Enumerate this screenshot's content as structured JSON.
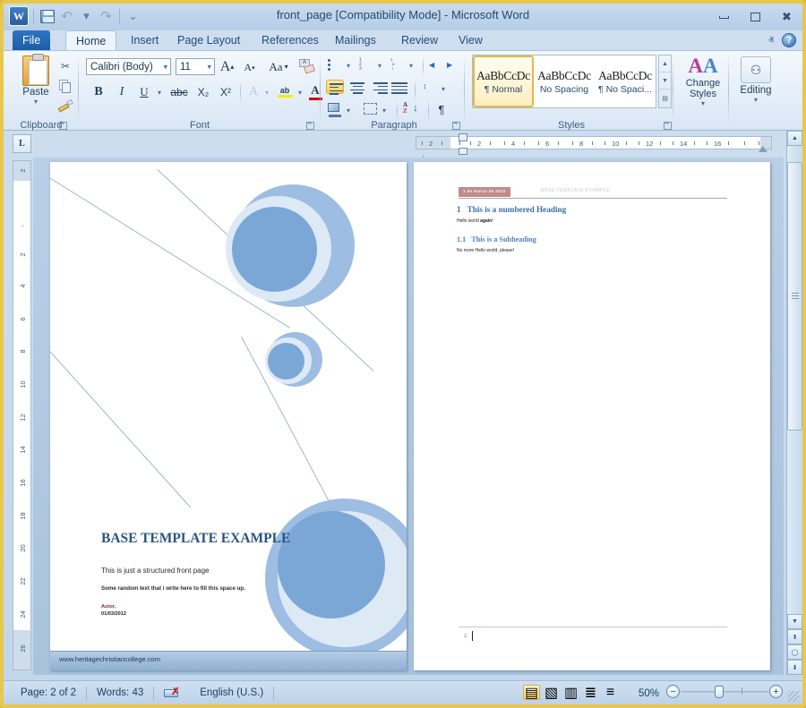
{
  "window": {
    "title": "front_page [Compatibility Mode]  -  Microsoft Word",
    "app_logo": "W",
    "minimize": "minimize-icon",
    "restore": "restore-icon",
    "close": "✖"
  },
  "quick_access": {
    "save": "save-icon",
    "undo": "↶",
    "redo": "↷",
    "customize": "≡▾"
  },
  "tabs": [
    {
      "label": "File",
      "id": "file"
    },
    {
      "label": "Home",
      "id": "home"
    },
    {
      "label": "Insert",
      "id": "insert"
    },
    {
      "label": "Page Layout",
      "id": "page-layout"
    },
    {
      "label": "References",
      "id": "references"
    },
    {
      "label": "Mailings",
      "id": "mailings"
    },
    {
      "label": "Review",
      "id": "review"
    },
    {
      "label": "View",
      "id": "view"
    }
  ],
  "ribbon_help": {
    "collapse": "ⱏ",
    "help": "?"
  },
  "ribbon": {
    "clipboard": {
      "name": "Clipboard",
      "paste": "Paste",
      "cut": "✂",
      "copy": "copy-icon",
      "format_painter": "format-painter-icon"
    },
    "font": {
      "name": "Font",
      "font_family": "Calibri (Body)",
      "font_size": "11",
      "grow_font": "A",
      "shrink_font": "A",
      "change_case": "Aa",
      "clear_formatting": "clear-formatting-icon",
      "bold": "B",
      "italic": "I",
      "underline": "U",
      "strikethrough": "abc",
      "subscript": "X₂",
      "superscript": "X²",
      "text_effects": "A",
      "highlight": "ab",
      "font_color": "A"
    },
    "paragraph": {
      "name": "Paragraph",
      "bullets": "bullets-icon",
      "numbering": "numbering-icon",
      "multilevel": "multilevel-list-icon",
      "decrease_indent": "decrease-indent-icon",
      "increase_indent": "increase-indent-icon",
      "align_left": "align-left-icon",
      "align_center": "align-center-icon",
      "align_right": "align-right-icon",
      "justify": "justify-icon",
      "line_spacing": "line-spacing-icon",
      "shading": "shading-icon",
      "borders": "borders-icon",
      "sort": "AZ",
      "show_marks": "¶"
    },
    "styles": {
      "name": "Styles",
      "items": [
        {
          "preview": "AaBbCcDc",
          "label": "¶ Normal",
          "selected": true
        },
        {
          "preview": "AaBbCcDc",
          "label": "No Spacing",
          "selected": false
        },
        {
          "preview": "AaBbCcDc",
          "label": "¶ No Spaci...",
          "selected": false
        }
      ],
      "change_styles": "Change Styles"
    },
    "editing": {
      "name": "Editing",
      "label": "Editing",
      "icon": "binoculars-icon"
    }
  },
  "ruler": {
    "tab_stop": "L",
    "h_ticks": [
      "2",
      "1",
      "2",
      "4",
      "6",
      "8",
      "10",
      "12",
      "14",
      "16"
    ],
    "v_ticks": [
      "2",
      "",
      "2",
      "4",
      "6",
      "8",
      "10",
      "12",
      "14",
      "16",
      "18",
      "20",
      "22",
      "24",
      "26"
    ]
  },
  "document": {
    "page1": {
      "title": "BASE TEMPLATE EXAMPLE",
      "subtitle": "This is just a structured front page",
      "random_text": "Some random text that i write here to fill this space up.",
      "author": "Autor,",
      "date": "01/03/2012",
      "website": "www.heritagechristiancollege.com"
    },
    "page2": {
      "header_date": "1 de marzo de 2012",
      "header_title": "BASE TEMPLATE EXAMPLE",
      "heading_number": "1",
      "heading_text": "This is a numbered  Heading",
      "body1_plain": "Hello world ",
      "body1_bold": "again",
      "body1_tail": "!",
      "subheading_number": "1.1",
      "subheading_text": "This is a Subheading",
      "body2": "No more Hello world, please!",
      "page_number": "2"
    }
  },
  "status_bar": {
    "page": "Page: 2 of 2",
    "words": "Words: 43",
    "proofing": "proofing-errors-icon",
    "language": "English (U.S.)",
    "views": [
      {
        "name": "print-layout",
        "icon": "▤",
        "selected": true
      },
      {
        "name": "full-screen-reading",
        "icon": "▧",
        "selected": false
      },
      {
        "name": "web-layout",
        "icon": "▥",
        "selected": false
      },
      {
        "name": "outline",
        "icon": "≣",
        "selected": false
      },
      {
        "name": "draft",
        "icon": "≡",
        "selected": false
      }
    ],
    "zoom": "50%",
    "zoom_out": "−",
    "zoom_in": "+"
  },
  "colors": {
    "accent_blue": "#7ba7d7",
    "circle_mid": "#dee9f6",
    "circle_outer": "#9dbde2",
    "heading_blue": "#3c6fa8",
    "header_band": "#bf8c8c",
    "title_blue": "#28547f",
    "window_chrome": "#c2d6ec",
    "selection_gold": "#ffcf5e"
  }
}
